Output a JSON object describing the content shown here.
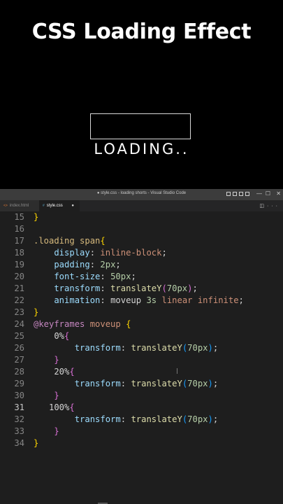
{
  "video": {
    "title": "CSS Loading Effect",
    "loading_text": "LOADING.."
  },
  "vscode": {
    "window_title": "● style.css - loading shorts - Visual Studio Code",
    "tabs": [
      {
        "label": "index.html",
        "icon": "html-file-icon",
        "active": false
      },
      {
        "label": "style.css",
        "icon": "css-file-icon",
        "active": true,
        "modified_dot": "●"
      }
    ],
    "editor": {
      "lines": [
        {
          "n": "15",
          "segments": [
            {
              "t": "}",
              "c": "br1"
            }
          ]
        },
        {
          "n": "16",
          "segments": []
        },
        {
          "n": "17",
          "segments": [
            {
              "t": ".loading span",
              "c": "sel"
            },
            {
              "t": "{",
              "c": "br1"
            }
          ]
        },
        {
          "n": "18",
          "segments": [
            {
              "t": "    display",
              "c": "prop"
            },
            {
              "t": ": ",
              "c": "pun"
            },
            {
              "t": "inline-block",
              "c": "val"
            },
            {
              "t": ";",
              "c": "pun"
            }
          ]
        },
        {
          "n": "19",
          "segments": [
            {
              "t": "    padding",
              "c": "prop"
            },
            {
              "t": ": ",
              "c": "pun"
            },
            {
              "t": "2px",
              "c": "nm"
            },
            {
              "t": ";",
              "c": "pun"
            }
          ]
        },
        {
          "n": "20",
          "segments": [
            {
              "t": "    font-size",
              "c": "prop"
            },
            {
              "t": ": ",
              "c": "pun"
            },
            {
              "t": "50px",
              "c": "nm"
            },
            {
              "t": ";",
              "c": "pun"
            }
          ]
        },
        {
          "n": "21",
          "segments": [
            {
              "t": "    transform",
              "c": "prop"
            },
            {
              "t": ": ",
              "c": "pun"
            },
            {
              "t": "translateY",
              "c": "fn"
            },
            {
              "t": "(",
              "c": "br2"
            },
            {
              "t": "70px",
              "c": "nm"
            },
            {
              "t": ")",
              "c": "br2"
            },
            {
              "t": ";",
              "c": "pun"
            }
          ]
        },
        {
          "n": "22",
          "segments": [
            {
              "t": "    animation",
              "c": "prop"
            },
            {
              "t": ": ",
              "c": "pun"
            },
            {
              "t": "moveup ",
              "c": "pun"
            },
            {
              "t": "3s",
              "c": "nm"
            },
            {
              "t": " linear infinite",
              "c": "val"
            },
            {
              "t": ";",
              "c": "pun"
            }
          ]
        },
        {
          "n": "23",
          "segments": [
            {
              "t": "}",
              "c": "br1"
            }
          ]
        },
        {
          "n": "24",
          "segments": [
            {
              "t": "@keyframes",
              "c": "kw"
            },
            {
              "t": " moveup ",
              "c": "val"
            },
            {
              "t": "{",
              "c": "br1"
            }
          ]
        },
        {
          "n": "25",
          "segments": [
            {
              "t": "    0%",
              "c": "pun"
            },
            {
              "t": "{",
              "c": "br2"
            }
          ]
        },
        {
          "n": "26",
          "segments": [
            {
              "t": "        transform",
              "c": "prop"
            },
            {
              "t": ": ",
              "c": "pun"
            },
            {
              "t": "translateY",
              "c": "fn"
            },
            {
              "t": "(",
              "c": "br3"
            },
            {
              "t": "70px",
              "c": "nm"
            },
            {
              "t": ")",
              "c": "br3"
            },
            {
              "t": ";",
              "c": "pun"
            }
          ]
        },
        {
          "n": "27",
          "segments": [
            {
              "t": "    }",
              "c": "br2"
            }
          ]
        },
        {
          "n": "28",
          "segments": [
            {
              "t": "    20%",
              "c": "pun"
            },
            {
              "t": "{",
              "c": "br2"
            }
          ]
        },
        {
          "n": "29",
          "segments": [
            {
              "t": "        transform",
              "c": "prop"
            },
            {
              "t": ": ",
              "c": "pun"
            },
            {
              "t": "translateY",
              "c": "fn"
            },
            {
              "t": "(",
              "c": "br3"
            },
            {
              "t": "70px",
              "c": "nm"
            },
            {
              "t": ")",
              "c": "br3"
            },
            {
              "t": ";",
              "c": "pun"
            }
          ]
        },
        {
          "n": "30",
          "segments": [
            {
              "t": "    }",
              "c": "br2"
            }
          ]
        },
        {
          "n": "31",
          "segments": [
            {
              "t": "   100%",
              "c": "pun"
            },
            {
              "t": "{",
              "c": "br2"
            }
          ],
          "current": true
        },
        {
          "n": "32",
          "segments": [
            {
              "t": "        transform",
              "c": "prop"
            },
            {
              "t": ": ",
              "c": "pun"
            },
            {
              "t": "translateY",
              "c": "fn"
            },
            {
              "t": "(",
              "c": "br3"
            },
            {
              "t": "70px",
              "c": "nm"
            },
            {
              "t": ")",
              "c": "br3"
            },
            {
              "t": ";",
              "c": "pun"
            }
          ]
        },
        {
          "n": "33",
          "segments": [
            {
              "t": "    }",
              "c": "br2"
            }
          ]
        },
        {
          "n": "34",
          "segments": [
            {
              "t": "}",
              "c": "br1"
            }
          ]
        }
      ]
    }
  }
}
